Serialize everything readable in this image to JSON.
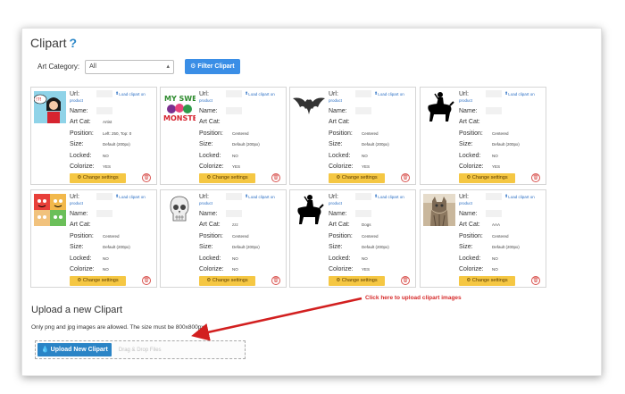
{
  "page": {
    "title": "Clipart",
    "help": "?"
  },
  "filter": {
    "label": "Art Category:",
    "selected": "All",
    "button": "Filter Clipart"
  },
  "labels": {
    "url": "Url:",
    "link": "Load clipart on",
    "product": "product",
    "name": "Name:",
    "artcat": "Art Cat:",
    "position": "Position:",
    "size": "Size:",
    "locked": "Locked:",
    "colorize": "Colorize:",
    "change": "Change settings"
  },
  "cliparts": [
    {
      "artcat": "Artist",
      "position": "Left: 250, Top: 0",
      "size": "Default (200px)",
      "locked": "NO",
      "colorize": "YES",
      "thumb": "comic-woman"
    },
    {
      "artcat": "",
      "position": "Centered",
      "size": "Default (200px)",
      "locked": "NO",
      "colorize": "YES",
      "thumb": "my-sweet-monsters"
    },
    {
      "artcat": "",
      "position": "Centered",
      "size": "Default (200px)",
      "locked": "NO",
      "colorize": "YES",
      "thumb": "bat-silhouette"
    },
    {
      "artcat": "",
      "position": "Centered",
      "size": "Default (200px)",
      "locked": "NO",
      "colorize": "YES",
      "thumb": "bull-rider-silhouette"
    },
    {
      "artcat": "",
      "position": "Centered",
      "size": "Default (200px)",
      "locked": "NO",
      "colorize": "NO",
      "thumb": "cartoon-faces"
    },
    {
      "artcat": "zzz",
      "position": "Centered",
      "size": "Default (200px)",
      "locked": "NO",
      "colorize": "NO",
      "thumb": "skull"
    },
    {
      "artcat": "Dogs",
      "position": "Centered",
      "size": "Default (200px)",
      "locked": "NO",
      "colorize": "YES",
      "thumb": "bull-rider-silhouette"
    },
    {
      "artcat": "AAA",
      "position": "Centered",
      "size": "Default (200px)",
      "locked": "NO",
      "colorize": "NO",
      "thumb": "cat-photo"
    }
  ],
  "upload": {
    "title": "Upload a new Clipart",
    "subtitle": "Only png and jpg images are allowed. The size must be 800x800px",
    "button": "Upload New Clipart",
    "drop": "Drag & Drop Files"
  },
  "annotation": {
    "text": "Click here to upload clipart images",
    "color": "#d62b2b"
  }
}
